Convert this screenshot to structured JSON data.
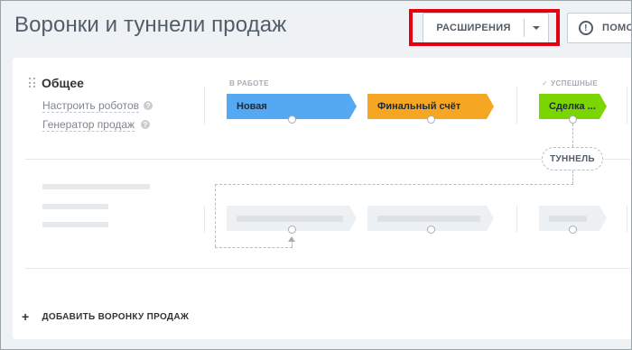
{
  "page": {
    "title": "Воронки и туннели продаж"
  },
  "toolbar": {
    "extensions_label": "РАСШИРЕНИЯ",
    "help_label": "ПОМО"
  },
  "funnel": {
    "name": "Общее",
    "links": {
      "robots": "Настроить роботов",
      "generator": "Генератор продаж"
    },
    "groups": {
      "in_work": "В РАБОТЕ",
      "successful": "УСПЕШНЫЕ"
    },
    "stages": [
      {
        "label": "Новая",
        "color": "#55a8f2"
      },
      {
        "label": "Финальный счёт",
        "color": "#f5a623"
      },
      {
        "label": "Сделка ...",
        "color": "#7bd500"
      }
    ]
  },
  "tunnel": {
    "label": "ТУННЕЛЬ"
  },
  "add_funnel": {
    "label": "ДОБАВИТЬ ВОРОНКУ ПРОДАЖ"
  },
  "colors": {
    "highlight": "#e3000f"
  },
  "icons": {
    "help": "question-circle-icon",
    "caret": "chevron-down-icon",
    "plus": "plus-icon",
    "drag": "drag-handle-icon",
    "hint": "question-hint-icon",
    "check": "check-icon"
  }
}
